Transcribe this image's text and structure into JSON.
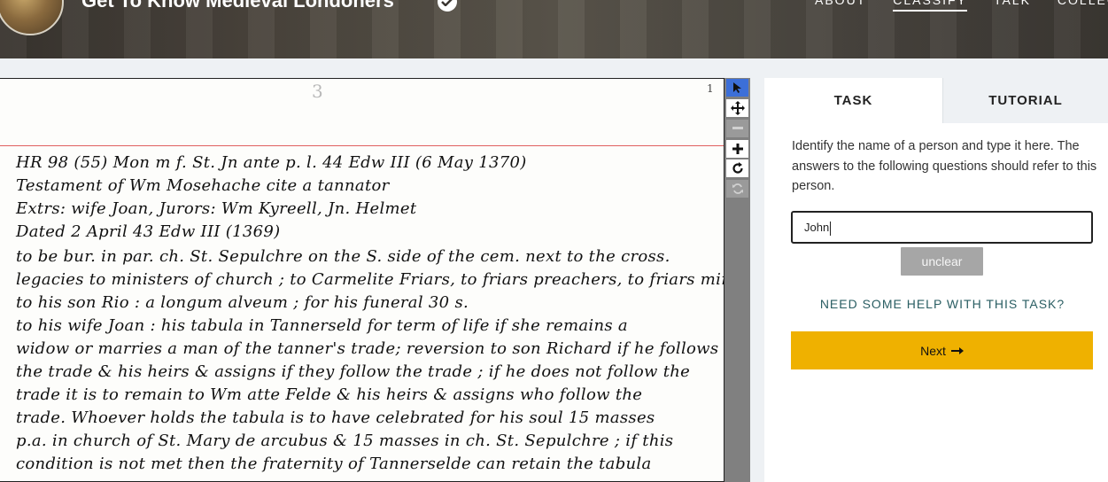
{
  "header": {
    "project_title": "Get To Know Medieval Londoners",
    "nav": [
      "ABOUT",
      "CLASSIFY",
      "TALK",
      "COLLECT"
    ],
    "active_nav": "CLASSIFY"
  },
  "subject": {
    "page_numbers": [
      "3",
      "1"
    ],
    "lines": [
      "HR 98 (55)        Mon  m  f.  St.  Jn  ante  p. l.   44  Edw III  (6 May  1370)",
      "Testament  of    Wm  Mosehache   cite a  tannator",
      "Extrs:  wife  Joan,              Jurors:  Wm  Kyreell,  Jn.  Helmet",
      "Dated   2  April  43  Edw III   (1369)",
      "to be bur.  in  par. ch.  St. Sepulchre    on  the  S.  side  of  the  cem.  next  to  the  cross.",
      "legacies  to   ministers  of  church ;   to  Carmelite  Friars,   to  friars  preachers,  to friars  minor.",
      "to his son  Rio :     a   longum   alveum ;    for  his  funeral    30 s.",
      "to his  wife  Joan :    his   tabula    in   Tannerseld      for  term  of  life   if  she  remains a",
      "widow  or   marries   a  man  of  the   tanner's  trade;   reversion  to  son  Richard   if  he  follows",
      "the  trade  &  his  heirs  & assigns    if  they   follow  the  trade ;   if  he  does  not  follow  the",
      "trade   it  is   to  remain   to   Wm   atte  Felde   &  his  heirs  & assigns   who   follow  the",
      "trade.      Whoever  holds  the  tabula   is   to  have   celebrated   for  his  soul  15 masses",
      "p.a.   in   church  of   St.  Mary  de  arcubus   &  15  masses  in  ch.  St. Sepulchre ;  if  this",
      "condition  is   not   met    then  the    fraternity  of   Tannerselde    can  retain  the  tabula"
    ]
  },
  "tools": [
    "pointer-tool",
    "move-tool",
    "zoom-out",
    "zoom-in",
    "rotate",
    "reset"
  ],
  "panel": {
    "tabs": [
      "TASK",
      "TUTORIAL"
    ],
    "instructions": "Identify the name of a person and type it here. The answers to the following questions should refer to this person.",
    "answer_value": "John",
    "unclear_label": "unclear",
    "help_label": "NEED SOME HELP WITH THIS TASK?",
    "next_label": "Next"
  },
  "colors": {
    "next_button": "#efb100",
    "active_tool": "#3c6fd8",
    "help_link": "#2a5e63",
    "unclear_button": "#a6a6a6"
  }
}
